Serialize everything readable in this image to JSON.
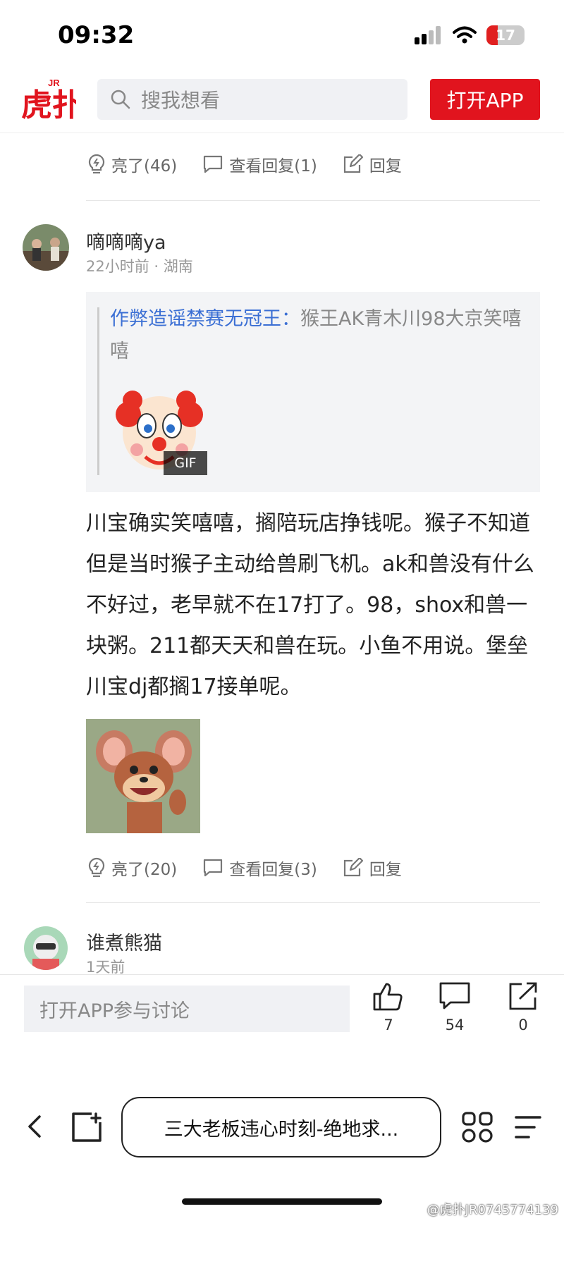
{
  "status_bar": {
    "time": "09:32",
    "battery": "17"
  },
  "header": {
    "search_placeholder": "搜我想看",
    "open_app_label": "打开APP"
  },
  "prev_comment_actions": {
    "like": "亮了(46)",
    "view_replies": "查看回复(1)",
    "reply": "回复"
  },
  "comment": {
    "username": "嘀嘀嘀ya",
    "meta": "22小时前 · 湖南",
    "quote_author": "作弊造谣禁赛无冠王：",
    "quote_text": "猴王AK青木川98大京笑嘻嘻",
    "gif_label": "GIF",
    "body": "川宝确实笑嘻嘻，搁陪玩店挣钱呢。猴子不知道但是当时猴子主动给兽刷飞机。ak和兽没有什么不好过，老早就不在17打了。98，shox和兽一块粥。211都天天和兽在玩。小鱼不用说。堡垒川宝dj都搁17接单呢。",
    "actions": {
      "like": "亮了(20)",
      "view_replies": "查看回复(3)",
      "reply": "回复"
    }
  },
  "next_comment": {
    "username": "谁煮熊猫",
    "meta": "1天前"
  },
  "bottom": {
    "discuss_placeholder": "打开APP参与讨论",
    "likes": "7",
    "comments": "54",
    "shares": "0"
  },
  "browser": {
    "tab_title": "三大老板违心时刻-绝地求..."
  },
  "watermark": "@虎扑JR0745774139",
  "colors": {
    "brand_red": "#e1141e",
    "link_blue": "#3b6fd4"
  }
}
